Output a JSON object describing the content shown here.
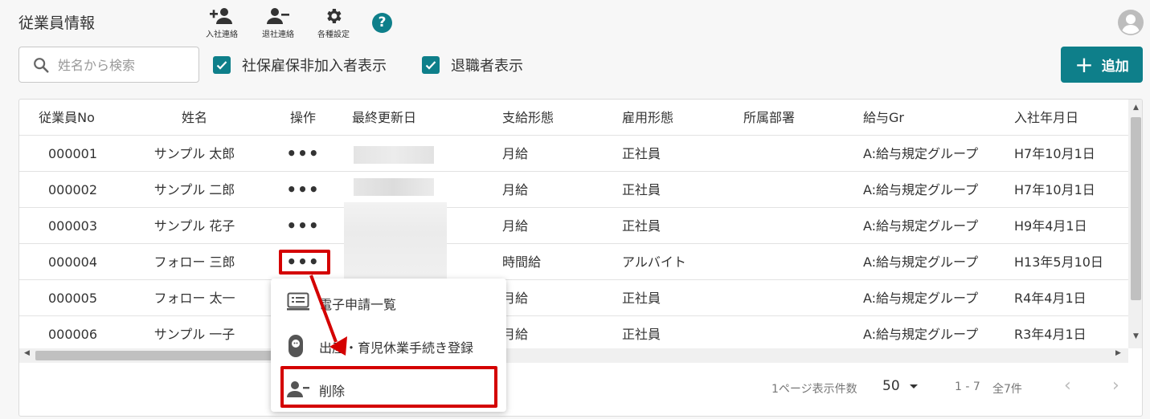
{
  "header": {
    "title": "従業員情報",
    "tools": [
      {
        "icon": "add-person-icon",
        "label": "入社連絡"
      },
      {
        "icon": "remove-person-icon",
        "label": "退社連絡"
      },
      {
        "icon": "gear-icon",
        "label": "各種設定"
      }
    ],
    "help": "?"
  },
  "filters": {
    "search_placeholder": "姓名から検索",
    "check1": "社保雇保非加入者表示",
    "check2": "退職者表示",
    "add_button": "追加",
    "add_symbol": "+"
  },
  "table": {
    "columns": [
      "従業員No",
      "姓名",
      "操作",
      "最終更新日",
      "支給形態",
      "雇用形態",
      "所属部署",
      "給与Gr",
      "入社年月日"
    ],
    "rows": [
      {
        "no": "000001",
        "name": "サンプル 太郎",
        "action": "•••",
        "pay": "月給",
        "emp": "正社員",
        "dept": "",
        "gr": "A:給与規定グループ",
        "date": "H7年10月1日"
      },
      {
        "no": "000002",
        "name": "サンプル 二郎",
        "action": "•••",
        "pay": "月給",
        "emp": "正社員",
        "dept": "",
        "gr": "A:給与規定グループ",
        "date": "H7年10月1日"
      },
      {
        "no": "000003",
        "name": "サンプル 花子",
        "action": "•••",
        "pay": "月給",
        "emp": "正社員",
        "dept": "",
        "gr": "A:給与規定グループ",
        "date": "H9年4月1日"
      },
      {
        "no": "000004",
        "name": "フォロー 三郎",
        "action": "•••",
        "pay": "時間給",
        "emp": "アルバイト",
        "dept": "",
        "gr": "A:給与規定グループ",
        "date": "H13年5月10日"
      },
      {
        "no": "000005",
        "name": "フォロー 太一",
        "action": "",
        "pay": "月給",
        "emp": "正社員",
        "dept": "",
        "gr": "A:給与規定グループ",
        "date": "R4年4月1日"
      },
      {
        "no": "000006",
        "name": "サンプル 一子",
        "action": "",
        "pay": "月給",
        "emp": "正社員",
        "dept": "",
        "gr": "A:給与規定グループ",
        "date": "R3年4月1日"
      }
    ]
  },
  "footer": {
    "per_page_label": "1ページ表示件数",
    "per_page_value": "50",
    "range": "1 - 7",
    "total": "全7件",
    "prev": "‹",
    "next": "›"
  },
  "menu": {
    "items": [
      {
        "icon": "list-icon",
        "label": "電子申請一覧"
      },
      {
        "icon": "baby-icon",
        "label": "出産・育児休業手続き登録"
      },
      {
        "icon": "remove-person-icon",
        "label": "削除"
      }
    ]
  },
  "colors": {
    "accent": "#0e7f8a",
    "highlight": "#d40000"
  }
}
